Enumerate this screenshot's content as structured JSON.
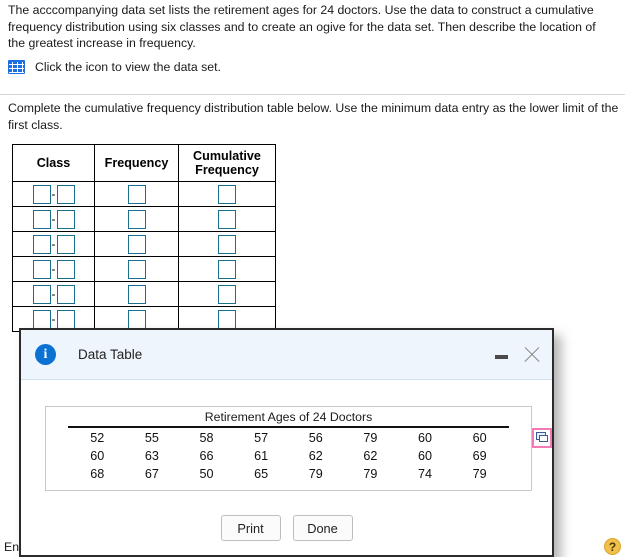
{
  "question": {
    "paragraph": "The acccompanying data set lists the retirement ages for 24 doctors. Use the data to construct a cumulative frequency distribution using six classes and to create an ogive for the data set. Then describe the location of the greatest increase in frequency.",
    "data_set_link_text": "Click the icon to view the data set.",
    "data_set_icon": "grid-table-icon",
    "instruction": "Complete the cumulative frequency distribution table below. Use the minimum data entry as the lower limit of the first class."
  },
  "answer_table": {
    "headers": [
      "Class",
      "Frequency",
      "Cumulative Frequency"
    ],
    "row_count": 6,
    "class_separator": "-",
    "input_value": ""
  },
  "modal": {
    "title": "Data Table",
    "info_icon": "info-circle-icon",
    "minimize_icon": "minimize-icon",
    "close_icon": "close-icon",
    "copy_icon": "copy-icon",
    "buttons": [
      {
        "label": "Print",
        "name": "print-button"
      },
      {
        "label": "Done",
        "name": "done-button"
      }
    ],
    "data": {
      "title": "Retirement Ages of 24 Doctors",
      "rows": [
        [
          "52",
          "55",
          "58",
          "57",
          "56",
          "79",
          "60",
          "60"
        ],
        [
          "60",
          "63",
          "66",
          "61",
          "62",
          "62",
          "60",
          "69"
        ],
        [
          "68",
          "67",
          "50",
          "65",
          "79",
          "79",
          "74",
          "79"
        ]
      ]
    }
  },
  "footer": {
    "partial_text": "En",
    "help_icon_label": "?"
  },
  "colors": {
    "input_border": "#1a6f8c",
    "link_icon": "#1b6fe0",
    "info_blue": "#0b72d4",
    "highlight_pink": "#f57ab6",
    "help_yellow": "#f0c04a",
    "titlebar_bg": "#eef5fd"
  }
}
